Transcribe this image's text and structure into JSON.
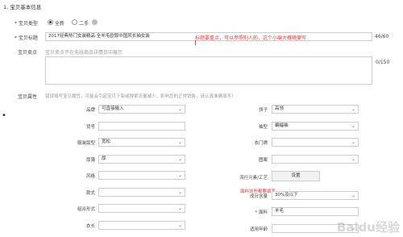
{
  "section": {
    "title": "1. 宝贝基本信息"
  },
  "type_row": {
    "label": "* 宝贝类型",
    "options": [
      "全新",
      "二手"
    ]
  },
  "title_row": {
    "label": "* 宝贝标题",
    "value": "2017经典热门女装精品 全羊毛欧版中国风长袖女装",
    "annotation": "标题要重点，可以参照别人的，这个小编大概随便写",
    "counter": "46/60"
  },
  "selling_point": {
    "label": "宝贝卖点",
    "hint": "宝贝卖点不在无线商品详情页中展示",
    "counter": "0/150"
  },
  "attributes": {
    "label": "宝贝属性",
    "hint": "错误填写宝贝属性，可能会引起宝贝下架或搜索流量减少，影响您的正常销售，请认真准确填写！",
    "left": [
      {
        "label": "品牌",
        "type": "select",
        "value": "可直接输入"
      },
      {
        "label": "货号",
        "type": "input",
        "value": ""
      },
      {
        "label": "服装版型",
        "type": "select",
        "value": "宽松"
      },
      {
        "label": "厚薄",
        "type": "select",
        "value": "厚"
      },
      {
        "label": "风格",
        "type": "select",
        "value": ""
      },
      {
        "label": "款式",
        "type": "select",
        "value": ""
      },
      {
        "label": "组合形式",
        "type": "select",
        "value": ""
      },
      {
        "label": "衣长",
        "type": "select",
        "value": ""
      }
    ],
    "right": [
      {
        "label": "领子",
        "type": "select",
        "value": "高领"
      },
      {
        "label": "袖型",
        "type": "select",
        "value": "蝙蝠袖"
      },
      {
        "label": "衣门襟",
        "type": "select",
        "value": ""
      },
      {
        "label": "图案",
        "type": "select",
        "value": ""
      },
      {
        "label": "流行元素/工艺",
        "type": "button",
        "value": "设置"
      },
      {
        "label": "成分含量",
        "type": "select",
        "value": "30%及以下"
      },
      {
        "label": "* 面料",
        "type": "input",
        "value": "羊毛"
      },
      {
        "label": "适用年龄",
        "type": "select",
        "value": ""
      }
    ],
    "annotation": "面料这些都要填写"
  },
  "watermark": "Baidu经验",
  "bullet": "•"
}
